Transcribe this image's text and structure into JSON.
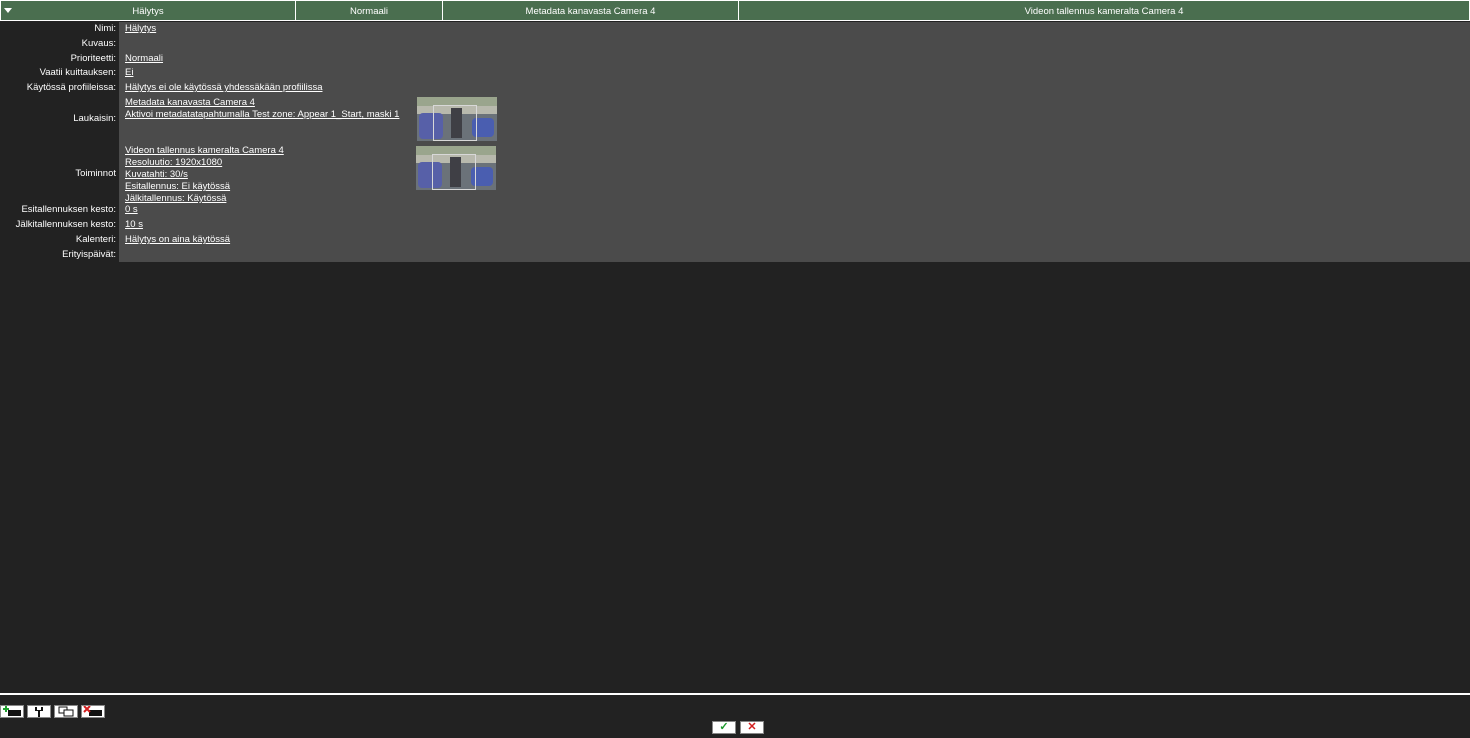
{
  "header": {
    "columns": [
      "Hälytys",
      "Normaali",
      "Metadata kanavasta Camera 4",
      "Videon tallennus kameralta Camera 4"
    ]
  },
  "details": {
    "name_label": "Nimi:",
    "name_value": "Hälytys",
    "description_label": "Kuvaus:",
    "priority_label": "Prioriteetti:",
    "priority_value": "Normaali",
    "ack_label": "Vaatii kuittauksen:",
    "ack_value": "Ei",
    "profiles_label": "Käytössä profiileissa:",
    "profiles_value": "Hälytys ei ole käytössä yhdessäkään profiilissa",
    "trigger_label": "Laukaisin:",
    "trigger_lines": [
      "Metadata kanavasta Camera 4",
      "Aktivoi metadatatapahtumalla Test zone: Appear 1_Start, maski 1"
    ],
    "actions_label": "Toiminnot",
    "action_lines": [
      "Videon tallennus kameralta Camera 4",
      "Resoluutio: 1920x1080",
      "Kuvatahti: 30/s",
      "Esitallennus: Ei käytössä",
      "Jälkitallennus: Käytössä"
    ],
    "prerecord_label": "Esitallennuksen kesto:",
    "prerecord_value": "0 s",
    "postrecord_label": "Jälkitallennuksen kesto:",
    "postrecord_value": "10 s",
    "calendar_label": "Kalenteri:",
    "calendar_value": "Hälytys on aina käytössä",
    "special_days_label": "Erityispäivät:"
  },
  "toolbar": {
    "icons": [
      "add-icon",
      "edit-icon",
      "copy-icon",
      "delete-icon"
    ]
  },
  "dialog": {
    "ok_symbol": "✓",
    "cancel_symbol": "✕"
  },
  "colors": {
    "header_green": "#4a6e4f",
    "panel_grey": "#4b4b4b",
    "background": "#222222"
  }
}
